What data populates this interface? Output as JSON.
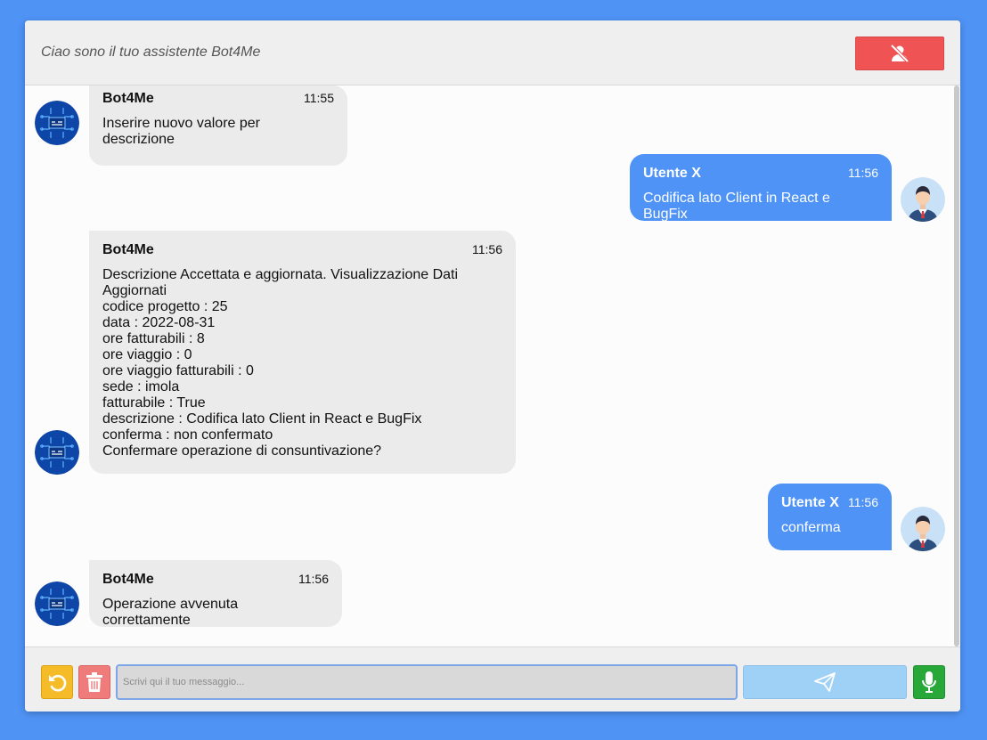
{
  "header": {
    "title": "Ciao sono il tuo assistente Bot4Me",
    "mute_icon": "mute-user-icon"
  },
  "colors": {
    "accent": "#4e93f5",
    "danger": "#f05353",
    "bot_bubble": "#ebebeb",
    "mic": "#29a83a",
    "undo": "#f6bb29"
  },
  "messages": [
    {
      "from": "bot",
      "sender": "Bot4Me",
      "time": "11:55",
      "lines": [
        "Inserire nuovo valore per descrizione"
      ]
    },
    {
      "from": "user",
      "sender": "Utente X",
      "time": "11:56",
      "lines": [
        "Codifica lato Client in React e BugFix"
      ]
    },
    {
      "from": "bot",
      "sender": "Bot4Me",
      "time": "11:56",
      "lines": [
        "Descrizione Accettata e aggiornata. Visualizzazione Dati",
        "Aggiornati",
        "codice progetto : 25",
        "data : 2022-08-31",
        "ore fatturabili : 8",
        "ore viaggio : 0",
        "ore viaggio fatturabili : 0",
        "sede : imola",
        "fatturabile : True",
        "descrizione : Codifica lato Client in React e BugFix",
        "conferma : non confermato",
        "Confermare operazione di consuntivazione?"
      ]
    },
    {
      "from": "user",
      "sender": "Utente X",
      "time": "11:56",
      "lines": [
        "conferma"
      ]
    },
    {
      "from": "bot",
      "sender": "Bot4Me",
      "time": "11:56",
      "lines": [
        "Operazione avvenuta correttamente"
      ]
    }
  ],
  "footer": {
    "input_placeholder": "Scrivi qui il tuo messaggio...",
    "input_value": "",
    "undo_icon": "undo-icon",
    "trash_icon": "trash-icon",
    "send_icon": "send-icon",
    "mic_icon": "microphone-icon"
  }
}
